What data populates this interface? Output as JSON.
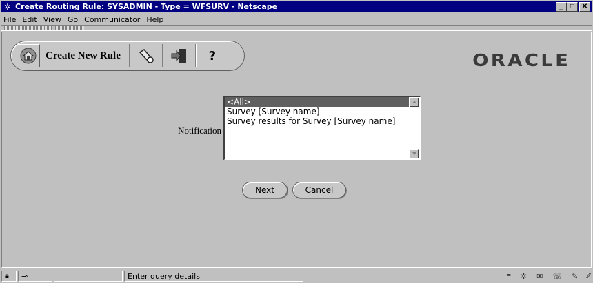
{
  "window": {
    "title": "Create Routing Rule: SYSADMIN - Type = WFSURV - Netscape",
    "minimize": "_",
    "maximize": "□",
    "close": "✕"
  },
  "menu": [
    "File",
    "Edit",
    "View",
    "Go",
    "Communicator",
    "Help"
  ],
  "app_toolbar": {
    "title": "Create New Rule",
    "icons": [
      "home-icon",
      "flashlight-icon",
      "exit-door-icon",
      "help-icon"
    ],
    "help_label": "?"
  },
  "logo": "ORACLE",
  "form": {
    "notification_label": "Notification",
    "options": [
      "<All>",
      "Survey [Survey name]",
      "Survey results for Survey [Survey name]"
    ],
    "selected_index": 0
  },
  "buttons": {
    "next": "Next",
    "cancel": "Cancel"
  },
  "status": {
    "message": "Enter query details"
  }
}
